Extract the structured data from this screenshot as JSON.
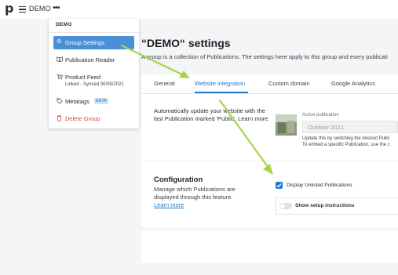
{
  "topbar": {
    "logo": "p",
    "crumb": "DEMO",
    "more": "•••"
  },
  "page": {
    "title": "“DEMO“ settings",
    "subtitle": "A group is a collection of Publications. The settings here apply to this group and every publicati"
  },
  "tabs": [
    {
      "label": "General",
      "active": false
    },
    {
      "label": "Website integration",
      "active": true
    },
    {
      "label": "Custom domain",
      "active": false
    },
    {
      "label": "Google Analytics",
      "active": false
    }
  ],
  "integration": {
    "info": "Automatically update your website with the last Publication marked 'Public'. Learn more.",
    "active_publication_label": "Active publication",
    "active_publication_value": "Outdoor 2021",
    "hint1": "Update this by switching the desired Publi",
    "hint2": "To embed a specific Publication, use the c"
  },
  "configuration": {
    "title": "Configuration",
    "description": "Manage which Publications are displayed through this feature.",
    "link": "Learn more",
    "checkbox_label": "Display Unlisted Publications",
    "checkbox_checked": true,
    "toggle_label": "Show setup instructions",
    "toggle_on": false
  },
  "menu": {
    "header": "DEMO",
    "items": [
      {
        "label": "Group Settings",
        "icon": "gear-icon",
        "active": true
      },
      {
        "label": "Publication Reader",
        "icon": "book-icon",
        "active": false
      },
      {
        "label": "Product Feed",
        "sub": "Linked - Synced 30/08/2021",
        "icon": "cart-icon",
        "active": false
      },
      {
        "label": "Metatags",
        "badge": "BETA",
        "icon": "tag-icon",
        "active": false
      },
      {
        "label": "Delete Group",
        "icon": "trash-icon",
        "active": false,
        "danger": true
      }
    ]
  },
  "colors": {
    "accent": "#1f7acb",
    "menu_active": "#4a90d9",
    "danger": "#d9443a",
    "annotation_arrow": "#a8d34a"
  }
}
